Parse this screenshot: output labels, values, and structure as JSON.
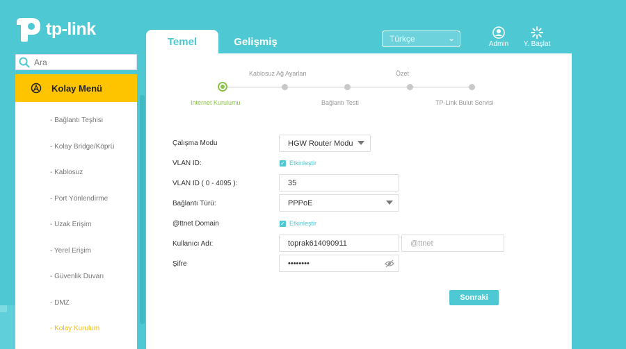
{
  "brand": {
    "logo_text": "tp-link"
  },
  "tabs": [
    {
      "label": "Temel",
      "active": true
    },
    {
      "label": "Gelişmiş",
      "active": false
    }
  ],
  "language": {
    "selected": "Türkçe"
  },
  "header_buttons": {
    "admin": "Admin",
    "restart": "Y. Başlat"
  },
  "search": {
    "placeholder": "Ara"
  },
  "sidebar": {
    "head": "Kolay Menü",
    "items": [
      "- Bağlantı Teşhisi",
      "- Kolay Bridge/Köprü",
      "- Kablosuz",
      "- Port Yönlendirme",
      "- Uzak Erişim",
      "- Yerel Erişim",
      "- Güvenlik Duvarı",
      "- DMZ",
      "- Kolay Kurulum"
    ],
    "active_index": 8
  },
  "steps": {
    "top": [
      "Kablosuz Ağ Ayarları",
      "Özet"
    ],
    "bottom": [
      "Internet Kurulumu",
      "Bağlantı Testi",
      "TP-Link Bulut Servisi"
    ]
  },
  "form": {
    "mode_label": "Çalışma Modu",
    "mode_value": "HGW Router Modu",
    "vlan_label": "VLAN ID:",
    "vlan_check": "Etkinleştir",
    "vlan_id_label": "VLAN ID ( 0 - 4095 ):",
    "vlan_id_value": "35",
    "conn_label": "Bağlantı Türü:",
    "conn_value": "PPPoE",
    "domain_label": "@ttnet Domain",
    "domain_check": "Etkinleştir",
    "user_label": "Kullanıcı Adı:",
    "user_value": "toprak614090911",
    "user_suffix": "@ttnet",
    "pass_label": "Şifre",
    "pass_value": "••••••••"
  },
  "next_label": "Sonraki",
  "colors": {
    "accent": "#4ec9d3",
    "menu_active": "#ffc400",
    "step_current": "#8bc34a"
  }
}
